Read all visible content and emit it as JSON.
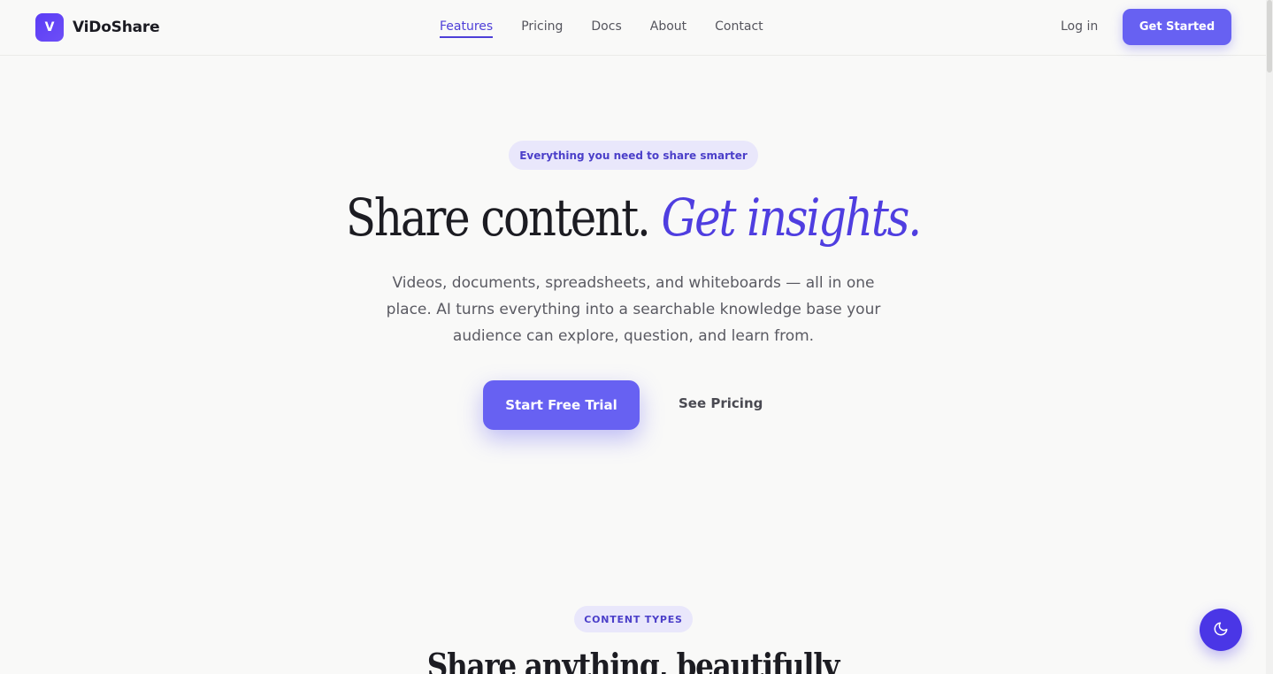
{
  "brand": {
    "logo_letter": "V",
    "name": "ViDoShare",
    "accent": "#6761f2"
  },
  "nav": {
    "items": [
      {
        "label": "Features",
        "active": true
      },
      {
        "label": "Pricing",
        "active": false
      },
      {
        "label": "Docs",
        "active": false
      },
      {
        "label": "About",
        "active": false
      },
      {
        "label": "Contact",
        "active": false
      }
    ],
    "login_label": "Log in",
    "cta_label": "Get Started"
  },
  "hero": {
    "badge": "Everything you need to share smarter",
    "headline_plain": "Share content. ",
    "headline_accent": "Get insights.",
    "subtext": "Videos, documents, spreadsheets, and whiteboards — all in one place. AI turns everything into a searchable knowledge base your audience can explore, question, and learn from.",
    "primary_cta": "Start Free Trial",
    "secondary_cta": "See Pricing"
  },
  "content_types": {
    "badge": "CONTENT TYPES",
    "title": "Share anything, beautifully"
  },
  "theme_toggle": {
    "icon": "moon-icon"
  }
}
